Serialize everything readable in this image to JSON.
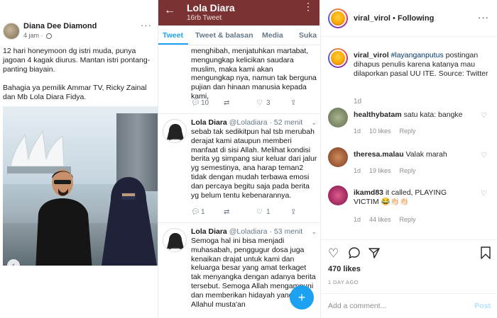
{
  "facebook": {
    "author": "Diana Dee Diamond",
    "time": "4 jam ·",
    "more": "···",
    "paragraphs": [
      "12 hari honeymoon dg istri muda, punya jagoan 4 kagak diurus. Mantan istri pontang-panting biayain.",
      "Bahagia ya pemilik Ammar TV, Ricky Zainal dan Mb Lola Diara Fidya."
    ],
    "photo_prev_icon": "‹"
  },
  "twitter": {
    "back_icon": "←",
    "title": "Lola Diara",
    "subtitle": "16rb Tweet",
    "menu_icon": "⋮",
    "tabs": [
      "Tweet",
      "Tweet & balasan",
      "Media",
      "Suka"
    ],
    "tweet0": {
      "text": "menghibah, menjatuhkan martabat, mengungkap kelicikan saudara muslim, maka kami akan mengungkap nya, namun tak berguna pujian dan hinaan manusia kepada kami,",
      "replies": "10",
      "retweets": "",
      "likes": "3"
    },
    "tweet1": {
      "name": "Lola Diara",
      "handle": "@Loladiara · 52 menit",
      "text": "sebab tak sedikitpun hal tsb merubah derajat kami ataupun memberi manfaat di sisi Allah. Melihat kondisi berita yg simpang siur keluar dari jalur yg semestinya, ana harap teman2 tidak dengan mudah terbawa emosi dan percaya begitu saja pada berita yg belum tentu kebenarannya.",
      "replies": "1",
      "retweets": "",
      "likes": "1"
    },
    "tweet2": {
      "name": "Lola Diara",
      "handle": "@Loladiara · 53 menit",
      "text": "Semoga hal ini bisa menjadi muhasabah, penggugur dosa juga kenaikan drajat untuk kami dan keluarga besar yang amat terkaget tak menyangka dengan adanya berita tersebut. Semoga Allah mengampuni dan memberikan hidayah yang luas. Allahul musta'an"
    },
    "fab_icon": "+"
  },
  "instagram": {
    "username": "viral_virol",
    "follow": "Following",
    "more": "···",
    "caption_user": "viral_virol",
    "caption_tag": "#layanganputus",
    "caption_text": " postingan dihapus penulis karena katanya mau dilaporkan pasal UU ITE. Source: Twitter",
    "caption_time": "1d",
    "comments": [
      {
        "user": "healthybatam",
        "text": "satu kata: bangke",
        "time": "1d",
        "likes": "10 likes",
        "reply": "Reply",
        "color": "#7e8b6a"
      },
      {
        "user": "theresa.malau",
        "text": "Valak marah",
        "time": "1d",
        "likes": "19 likes",
        "reply": "Reply",
        "color": "#a0522d"
      },
      {
        "user": "ikamd83",
        "text": "it called, PLAYING VICTIM 😂👏🏻👏🏻",
        "time": "1d",
        "likes": "44 likes",
        "reply": "Reply",
        "color": "#c2185b"
      }
    ],
    "likes_count": "470 likes",
    "date": "1 DAY AGO",
    "add_comment_placeholder": "Add a comment...",
    "post_label": "Post"
  },
  "colors": {
    "twitter_header": "#7a3232",
    "twitter_blue": "#1da1f2",
    "instagram_link": "#00376b"
  }
}
